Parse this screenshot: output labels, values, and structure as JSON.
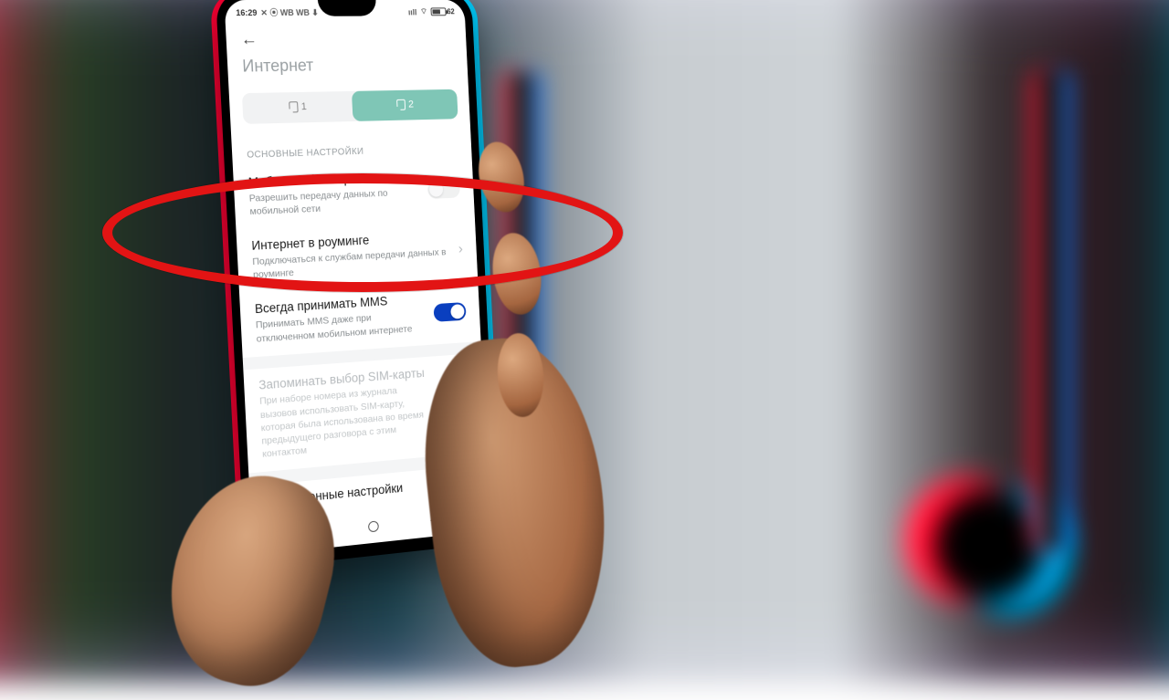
{
  "status": {
    "time": "16:29",
    "left_icons": "✕ ⦿ WB WB ⬇",
    "signal": "ııll",
    "wifi": "⌔",
    "battery_pct": "62"
  },
  "header": {
    "title": "Интернет"
  },
  "seg": {
    "tab1": "1",
    "tab2": "2"
  },
  "section_main": "ОСНОВНЫЕ НАСТРОЙКИ",
  "rows": {
    "data": {
      "t": "Мобильный интернет",
      "s": "Разрешить передачу данных по мобильной сети"
    },
    "roaming": {
      "t": "Интернет в роуминге",
      "s": "Подключаться к службам передачи данных в роуминге"
    },
    "mms": {
      "t": "Всегда принимать MMS",
      "s": "Принимать MMS даже при отключенном мобильном интернете"
    },
    "remember": {
      "t": "Запоминать выбор SIM-карты",
      "s": "При наборе номера из журнала вызовов использовать SIM-карту, которая была использована во время предыдущего разговора с этим контактом"
    },
    "advanced": {
      "t": "Расширенные настройки"
    }
  }
}
